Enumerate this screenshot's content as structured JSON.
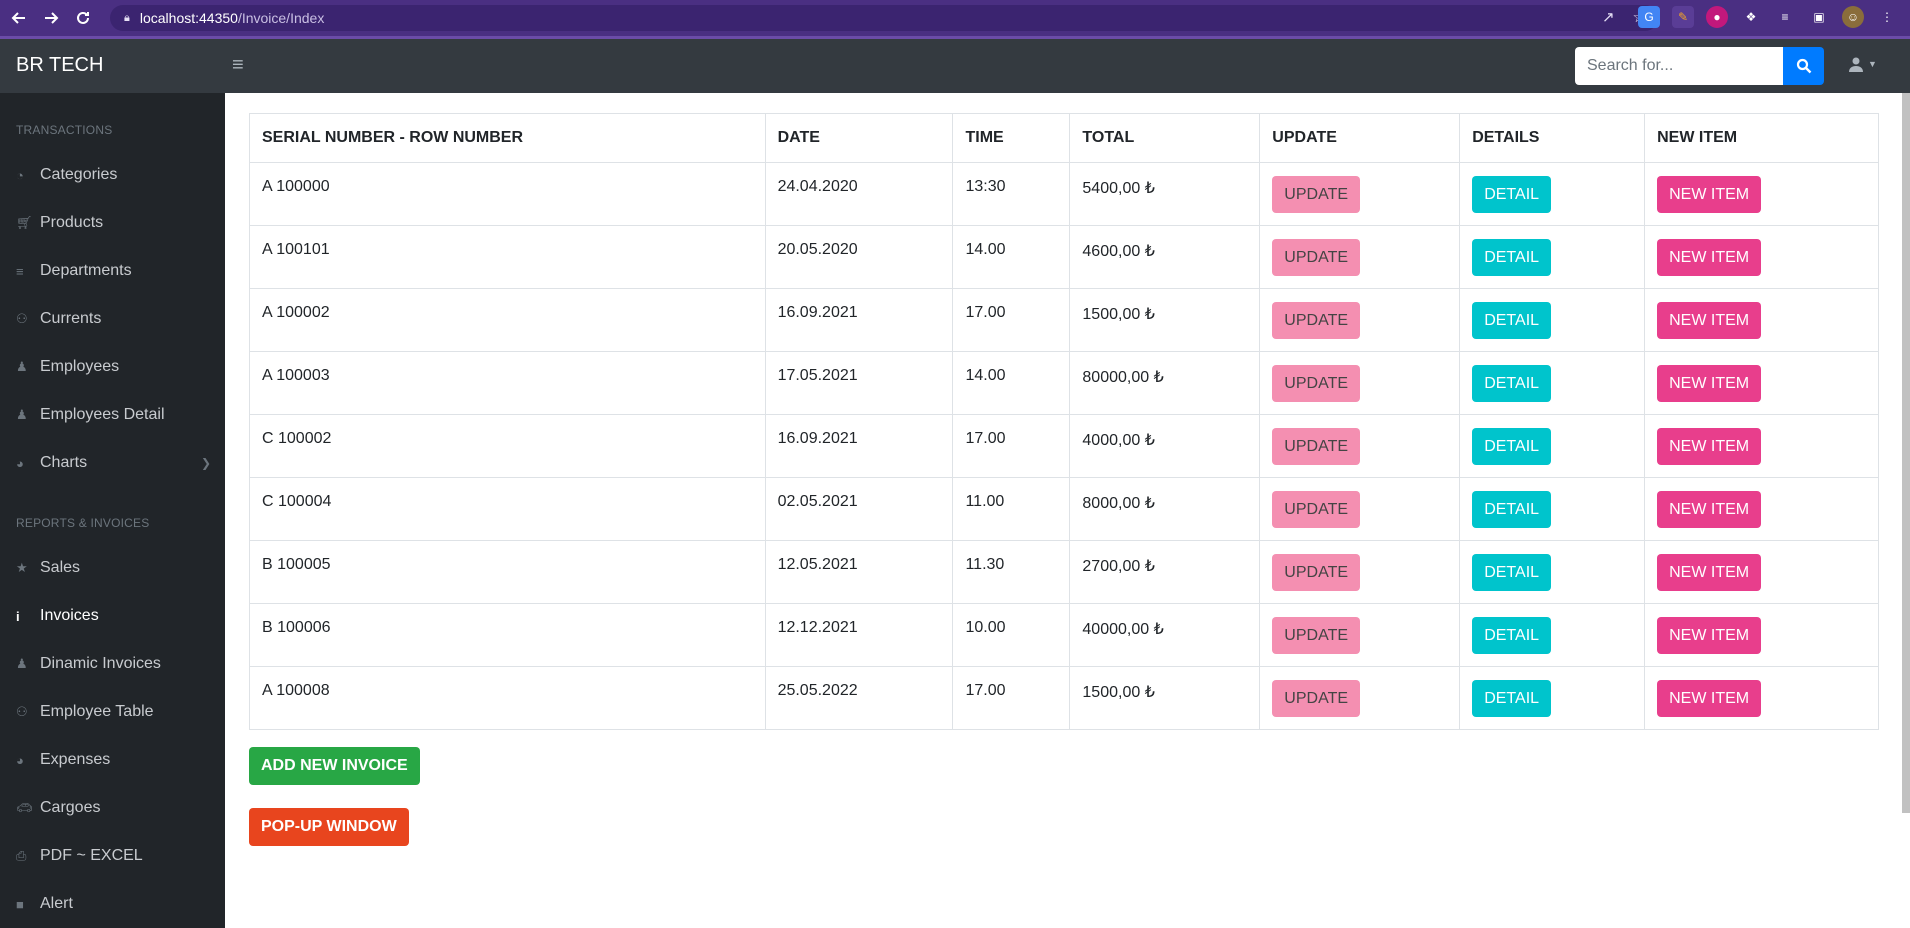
{
  "browser": {
    "url_host": "localhost:44350",
    "url_path": "/Invoice/Index"
  },
  "header": {
    "brand": "BR TECH",
    "search_placeholder": "Search for..."
  },
  "sidebar": {
    "heading_transactions": "TRANSACTIONS",
    "heading_reports": "REPORTS & INVOICES",
    "items": [
      {
        "label": "Categories",
        "icon": "tachometer-icon"
      },
      {
        "label": "Products",
        "icon": "cart-icon"
      },
      {
        "label": "Departments",
        "icon": "list-icon"
      },
      {
        "label": "Currents",
        "icon": "users-icon"
      },
      {
        "label": "Employees",
        "icon": "person-icon"
      },
      {
        "label": "Employees Detail",
        "icon": "person-icon"
      },
      {
        "label": "Charts",
        "icon": "pie-chart-icon"
      },
      {
        "label": "Sales",
        "icon": "star-icon"
      },
      {
        "label": "Invoices",
        "icon": "info-icon"
      },
      {
        "label": "Dinamic Invoices",
        "icon": "person-icon"
      },
      {
        "label": "Employee Table",
        "icon": "users-icon"
      },
      {
        "label": "Expenses",
        "icon": "pie-chart-icon"
      },
      {
        "label": "Cargoes",
        "icon": "car-icon"
      },
      {
        "label": "PDF ~ EXCEL",
        "icon": "print-icon"
      },
      {
        "label": "Alert",
        "icon": "box-icon"
      }
    ]
  },
  "table": {
    "headers": [
      "SERIAL NUMBER - ROW NUMBER",
      "DATE",
      "TIME",
      "TOTAL",
      "UPDATE",
      "DETAILS",
      "NEW ITEM"
    ],
    "rows": [
      {
        "serial": "A 100000",
        "date": "24.04.2020",
        "time": "13:30",
        "total": "5400,00 ₺"
      },
      {
        "serial": "A 100101",
        "date": "20.05.2020",
        "time": "14.00",
        "total": "4600,00 ₺"
      },
      {
        "serial": "A 100002",
        "date": "16.09.2021",
        "time": "17.00",
        "total": "1500,00 ₺"
      },
      {
        "serial": "A 100003",
        "date": "17.05.2021",
        "time": "14.00",
        "total": "80000,00 ₺"
      },
      {
        "serial": "C 100002",
        "date": "16.09.2021",
        "time": "17.00",
        "total": "4000,00 ₺"
      },
      {
        "serial": "C 100004",
        "date": "02.05.2021",
        "time": "11.00",
        "total": "8000,00 ₺"
      },
      {
        "serial": "B 100005",
        "date": "12.05.2021",
        "time": "11.30",
        "total": "2700,00 ₺"
      },
      {
        "serial": "B 100006",
        "date": "12.12.2021",
        "time": "10.00",
        "total": "40000,00 ₺"
      },
      {
        "serial": "A 100008",
        "date": "25.05.2022",
        "time": "17.00",
        "total": "1500,00 ₺"
      }
    ],
    "update_label": "UPDATE",
    "detail_label": "DETAIL",
    "new_item_label": "NEW ITEM"
  },
  "actions": {
    "add_invoice": "ADD NEW INVOICE",
    "popup": "POP-UP WINDOW"
  },
  "colors": {
    "update": "#f48fb1",
    "detail": "#00c4cc",
    "new_item": "#e83e8c",
    "add": "#28a745",
    "popup": "#e8451e"
  }
}
